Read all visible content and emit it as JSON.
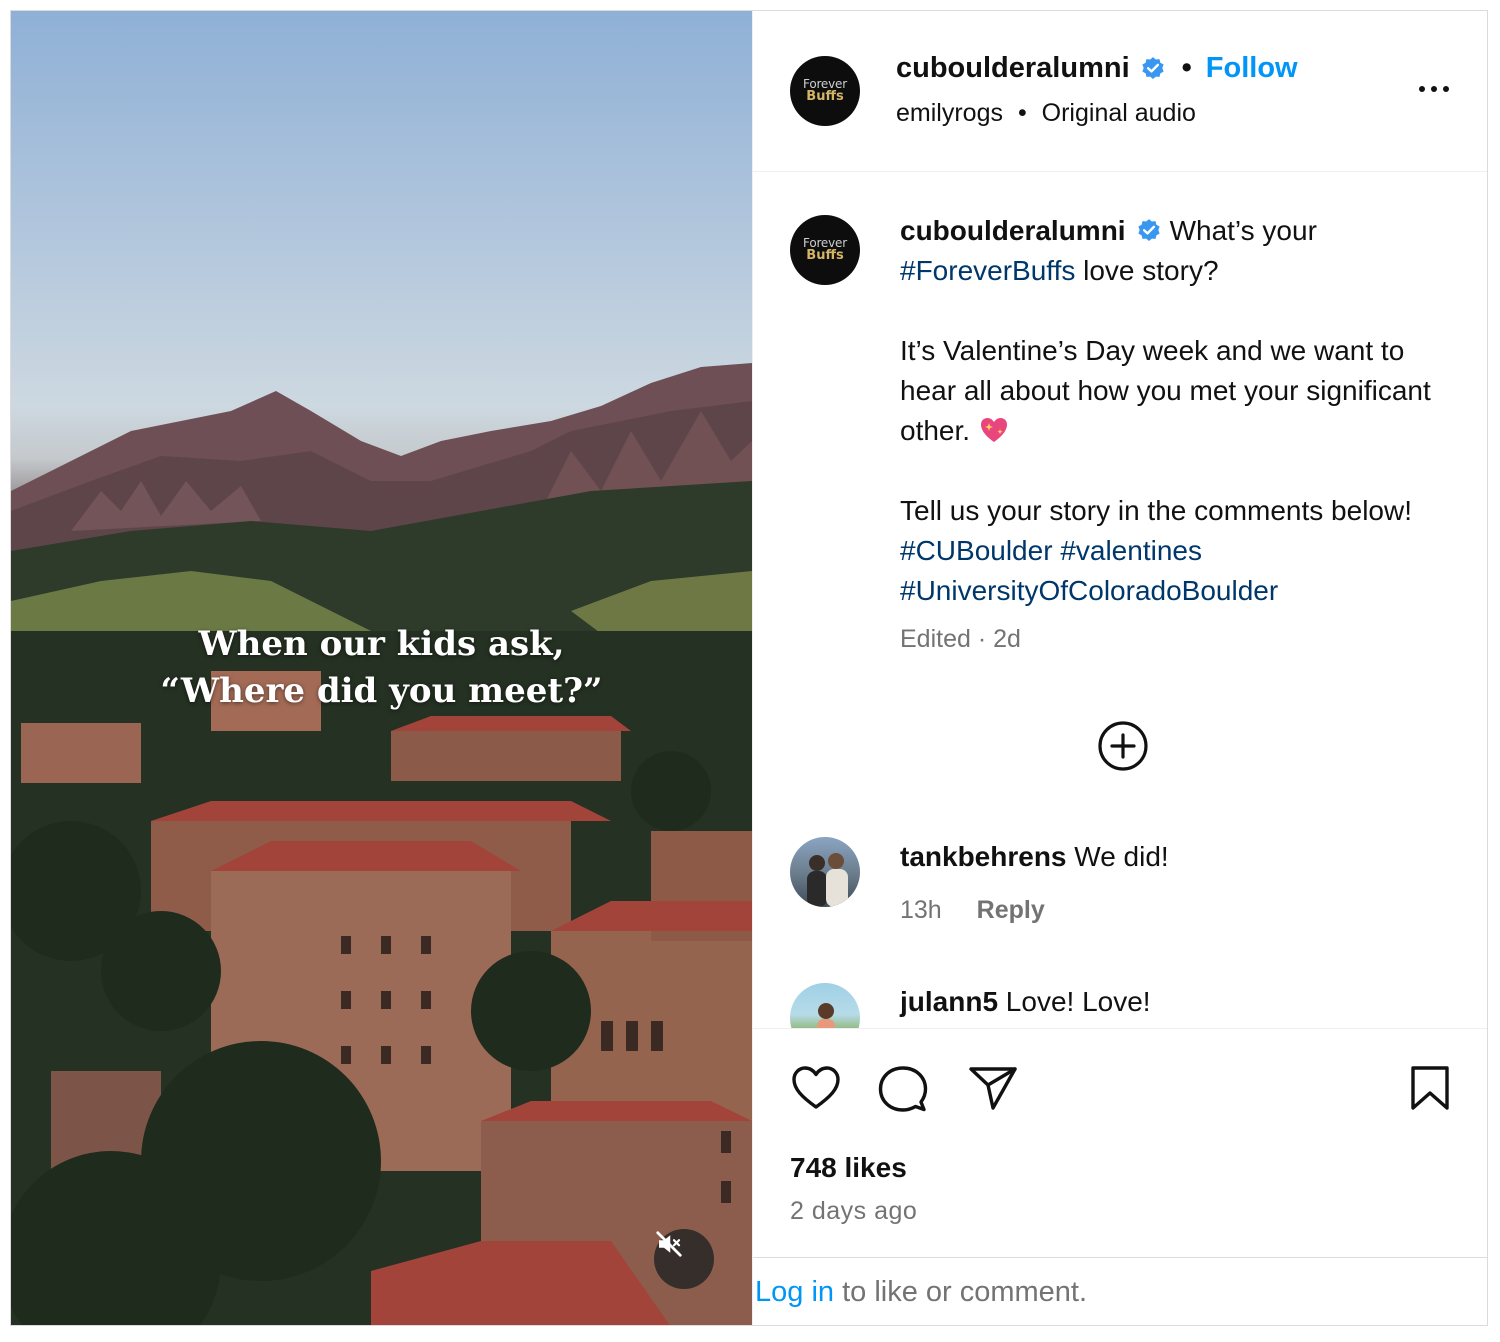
{
  "media": {
    "overlay_line1": "When our kids ask,",
    "overlay_line2": "“Where did you meet?”",
    "mute_icon": "speaker-muted-icon"
  },
  "header": {
    "avatar_line1": "Forever",
    "avatar_line2": "Buffs",
    "username": "cuboulderalumni",
    "separator": "•",
    "follow_label": "Follow",
    "audio_user": "emilyrogs",
    "audio_sep": "•",
    "audio_label": "Original audio",
    "more_icon": "more-options-icon"
  },
  "caption": {
    "username": "cuboulderalumni",
    "text_1": "What’s your",
    "hashtag_1": "#ForeverBuffs",
    "text_2": "love story?",
    "text_3": "It’s Valentine’s Day week and we want to hear all about how you met your significant other.",
    "emoji": "sparkling-heart",
    "text_4": "Tell us your story in the comments below!",
    "hashtag_2": "#CUBoulder",
    "hashtag_3": "#valentines",
    "hashtag_4": "#UniversityOfColoradoBoulder",
    "edited": "Edited · 2d"
  },
  "comments": [
    {
      "username": "tankbehrens",
      "text": "We did!",
      "time": "13h",
      "reply": "Reply"
    },
    {
      "username": "julann5",
      "text": "Love! Love!"
    }
  ],
  "actions": {
    "likes": "748 likes",
    "time_ago": "2 days ago"
  },
  "footer": {
    "login": "Log in",
    "rest": "to like or comment."
  },
  "colors": {
    "accent": "#0095f6",
    "hashtag": "#00376b",
    "muted": "#737373",
    "verified": "#3897f0"
  }
}
